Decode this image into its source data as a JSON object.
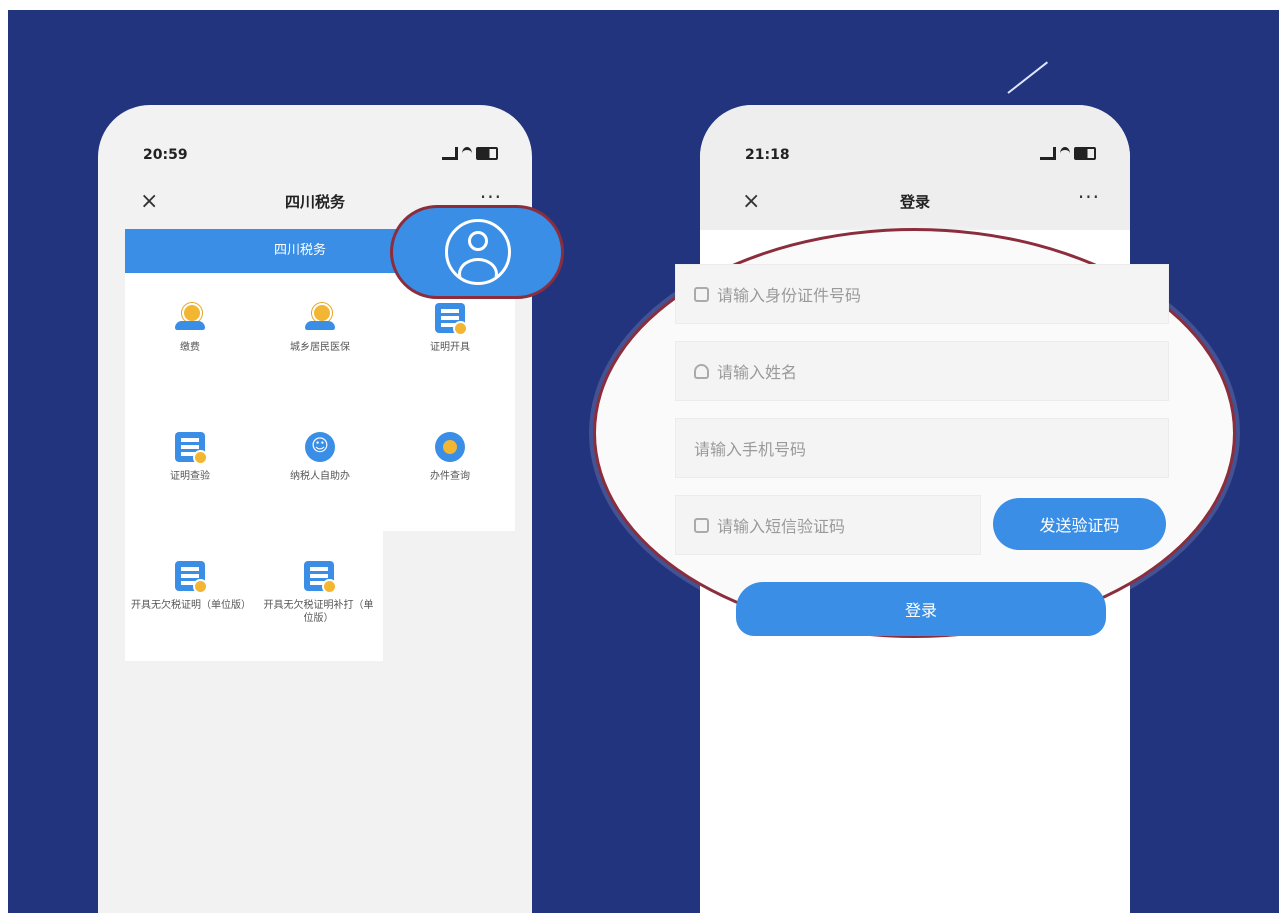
{
  "left_phone": {
    "status": {
      "time": "20:59"
    },
    "nav": {
      "close": "×",
      "title": "四川税务",
      "more": "···"
    },
    "tab_label": "四川税务",
    "grid_items": [
      {
        "label": "缴费",
        "icon": "coin-hand-icon"
      },
      {
        "label": "城乡居民医保",
        "icon": "coin-hand-icon"
      },
      {
        "label": "证明开具",
        "icon": "document-icon"
      },
      {
        "label": "证明查验",
        "icon": "document-icon"
      },
      {
        "label": "纳税人自助办",
        "icon": "circle-icon"
      },
      {
        "label": "办件查询",
        "icon": "check-circle-icon"
      },
      {
        "label": "开具无欠税证明（单位版）",
        "icon": "document-icon"
      },
      {
        "label": "开具无欠税证明补打（单位版）",
        "icon": "document-icon"
      }
    ]
  },
  "right_phone": {
    "status": {
      "time": "21:18"
    },
    "nav": {
      "close": "×",
      "title": "登录",
      "more": "···"
    },
    "fields": {
      "id_placeholder": "请输入身份证件号码",
      "name_placeholder": "请输入姓名",
      "phone_placeholder": "请输入手机号码",
      "sms_placeholder": "请输入短信验证码"
    },
    "send_code_label": "发送验证码",
    "login_label": "登录"
  },
  "colors": {
    "background": "#23347f",
    "accent": "#3a8ee6",
    "highlight_border": "#8b2d3c"
  }
}
